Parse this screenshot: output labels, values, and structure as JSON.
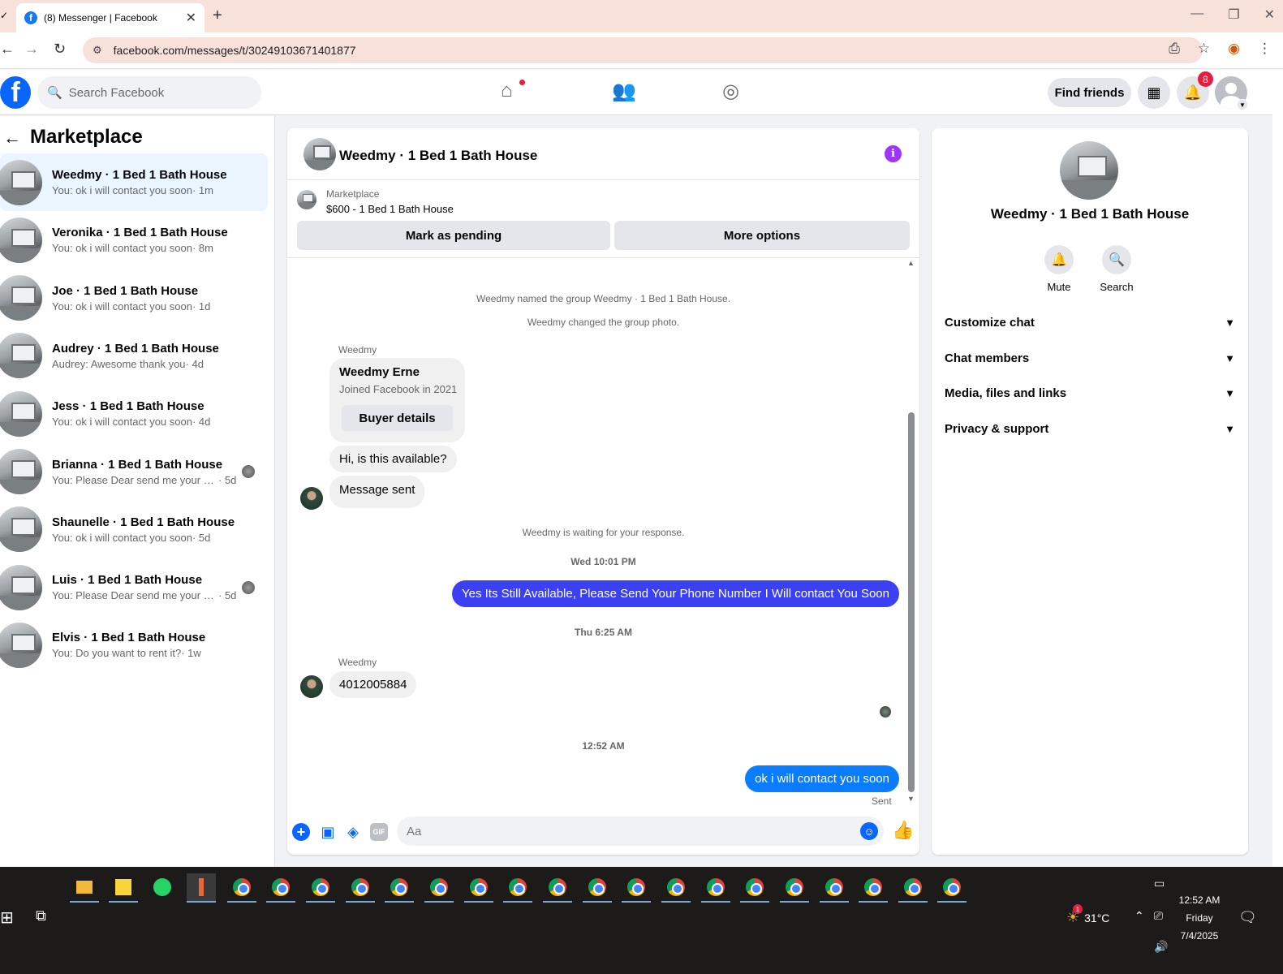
{
  "browser": {
    "tab_title": "(8) Messenger | Facebook",
    "tab_close": "✕",
    "new_tab": "+",
    "url": "facebook.com/messages/t/30249103671401877",
    "window_controls": [
      "—",
      "❐",
      "✕"
    ]
  },
  "header": {
    "search_placeholder": "Search Facebook",
    "find_friends": "Find friends",
    "notification_count": "8"
  },
  "sidebar": {
    "title": "Marketplace",
    "conversations": [
      {
        "name": "Weedmy · 1 Bed 1 Bath House",
        "preview": "You: ok i will contact you soon",
        "time": " · 1m",
        "active": true,
        "seen": false
      },
      {
        "name": "Veronika · 1 Bed 1 Bath House",
        "preview": "You: ok i will contact you soon",
        "time": " · 8m",
        "active": false,
        "seen": false
      },
      {
        "name": "Joe · 1 Bed 1 Bath House",
        "preview": "You: ok i will contact you soon",
        "time": " · 1d",
        "active": false,
        "seen": false
      },
      {
        "name": "Audrey · 1 Bed 1 Bath House",
        "preview": "Audrey: Awesome thank you",
        "time": " · 4d",
        "active": false,
        "seen": false
      },
      {
        "name": "Jess · 1 Bed 1 Bath House",
        "preview": "You: ok i will contact you soon",
        "time": " · 4d",
        "active": false,
        "seen": false
      },
      {
        "name": "Brianna · 1 Bed 1 Bath House",
        "preview": "You: Please Dear send me your nu...",
        "time": " · 5d",
        "active": false,
        "seen": true
      },
      {
        "name": "Shaunelle · 1 Bed 1 Bath House",
        "preview": "You: ok i will contact you soon",
        "time": " · 5d",
        "active": false,
        "seen": false
      },
      {
        "name": "Luis · 1 Bed 1 Bath House",
        "preview": "You: Please Dear send me your nu...",
        "time": " · 5d",
        "active": false,
        "seen": true
      },
      {
        "name": "Elvis · 1 Bed 1 Bath House",
        "preview": "You: Do you want to rent it?",
        "time": " · 1w",
        "active": false,
        "seen": false
      }
    ]
  },
  "chat": {
    "title": "Weedmy · 1 Bed 1 Bath House",
    "listing_label": "Marketplace",
    "listing_price": "$600 - 1 Bed 1 Bath House",
    "mark_pending": "Mark as pending",
    "more_options": "More options",
    "sys_named": "Weedmy named the group Weedmy · 1 Bed 1 Bath House.",
    "sys_photo": "Weedmy changed the group photo.",
    "sender_1": "Weedmy",
    "buyer_name": "Weedmy Erne",
    "buyer_joined": "Joined Facebook in 2021",
    "buyer_details": "Buyer details",
    "msg_available": "Hi, is this available?",
    "msg_sent": "Message sent",
    "sys_waiting": "Weedmy is waiting for your response.",
    "time_1": "Wed 10:01 PM",
    "msg_reply_1": "Yes Its Still Available, Please Send Your Phone Number I Will contact You Soon",
    "time_2": "Thu 6:25 AM",
    "sender_2": "Weedmy",
    "msg_phone": "4012005884",
    "time_3": "12:52 AM",
    "msg_reply_2": "ok i will contact you soon",
    "sent_status": "Sent",
    "input_placeholder": "Aa"
  },
  "details": {
    "name": "Weedmy · 1 Bed 1 Bath House",
    "mute": "Mute",
    "search": "Search",
    "sections": [
      "Customize chat",
      "Chat members",
      "Media, files and links",
      "Privacy & support"
    ]
  },
  "taskbar": {
    "temperature": "31°C",
    "weather_badge": "1",
    "time": "12:52 AM",
    "day": "Friday",
    "date": "7/4/2025"
  }
}
